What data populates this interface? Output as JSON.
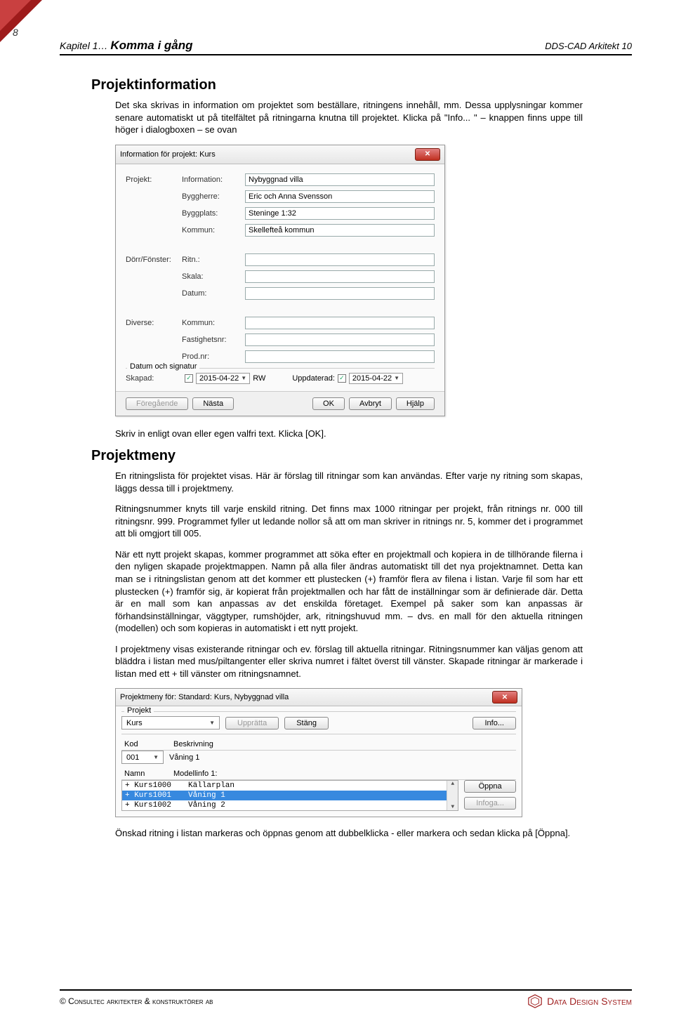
{
  "page_number": "8",
  "header": {
    "chapter": "Kapitel 1…",
    "title": "Komma i gång",
    "right": "DDS-CAD Arkitekt 10"
  },
  "section1": {
    "heading": "Projektinformation",
    "para": "Det ska skrivas in information om projektet som beställare, ritningens innehåll, mm. Dessa upplysningar kommer senare automatiskt ut på titelfältet på ritningarna knutna till projektet. Klicka på \"Info... \" – knappen finns uppe till höger i dialogboxen – se ovan"
  },
  "dialog1": {
    "title": "Information för projekt: Kurs",
    "projekt_label": "Projekt:",
    "rows_projekt": [
      {
        "label": "Information:",
        "value": "Nybyggnad villa"
      },
      {
        "label": "Byggherre:",
        "value": "Eric och Anna Svensson"
      },
      {
        "label": "Byggplats:",
        "value": "Steninge 1:32"
      },
      {
        "label": "Kommun:",
        "value": "Skellefteå kommun"
      }
    ],
    "dorr_label": "Dörr/Fönster:",
    "rows_dorr": [
      {
        "label": "Ritn.:",
        "value": ""
      },
      {
        "label": "Skala:",
        "value": ""
      },
      {
        "label": "Datum:",
        "value": ""
      }
    ],
    "diverse_label": "Diverse:",
    "rows_diverse": [
      {
        "label": "Kommun:",
        "value": ""
      },
      {
        "label": "Fastighetsnr:",
        "value": ""
      },
      {
        "label": "Prod.nr:",
        "value": ""
      }
    ],
    "signatur_label": "Datum och signatur",
    "skapad_label": "Skapad:",
    "skapad_date": "2015-04-22",
    "skapad_sign": "RW",
    "uppdaterad_label": "Uppdaterad:",
    "uppdaterad_date": "2015-04-22",
    "buttons": {
      "prev": "Föregående",
      "next": "Nästa",
      "ok": "OK",
      "cancel": "Avbryt",
      "help": "Hjälp"
    }
  },
  "after_dialog1": "Skriv in enligt ovan eller egen valfri text. Klicka [OK].",
  "section2": {
    "heading": "Projektmeny",
    "p1": "En ritningslista för projektet visas. Här är förslag till ritningar som kan användas. Efter varje ny ritning som skapas, läggs dessa till i projektmeny.",
    "p2": "Ritningsnummer knyts till varje enskild ritning. Det finns max 1000 ritningar per projekt, från ritnings nr. 000 till ritningsnr. 999. Programmet fyller ut ledande nollor så att om man skriver in ritnings nr. 5, kommer det i programmet att bli omgjort till 005.",
    "p3": "När ett nytt projekt skapas, kommer programmet att söka efter en projektmall och kopiera in de tillhörande filerna i den nyligen skapade projektmappen. Namn på alla filer ändras automatiskt till det nya projektnamnet. Detta kan man se i ritningslistan genom att det kommer ett plustecken (+) framför flera av filena i listan. Varje fil som har ett plustecken (+) framför sig, är kopierat från projektmallen och har fått de inställningar som är definierade där. Detta är en mall som kan anpassas av det enskilda företaget. Exempel på saker som kan anpassas är förhandsinställningar, väggtyper, rumshöjder, ark, ritningshuvud mm. – dvs. en mall för den aktuella ritningen (modellen) och som kopieras in automatiskt i ett nytt projekt.",
    "p4": "I projektmeny visas existerande ritningar och ev. förslag till aktuella ritningar. Ritningsnummer kan väljas genom att bläddra i listan med mus/piltangenter eller skriva numret i fältet överst till vänster. Skapade ritningar är markerade i listan med ett + till vänster om ritningsnamnet."
  },
  "dialog2": {
    "title": "Projektmeny för: Standard: Kurs, Nybyggnad villa",
    "projekt_label": "Projekt",
    "projekt_value": "Kurs",
    "uppratta": "Upprätta",
    "stang": "Stäng",
    "info": "Info...",
    "kod_label": "Kod",
    "beskrivning_label": "Beskrivning",
    "kod_value": "001",
    "beskrivning_value": "Våning 1",
    "namn_label": "Namn",
    "modell_label": "Modellinfo 1:",
    "rows": [
      {
        "name": "+ Kurs1000",
        "desc": "Källarplan"
      },
      {
        "name": "+ Kurs1001",
        "desc": "Våning 1"
      },
      {
        "name": "+ Kurs1002",
        "desc": "Våning 2"
      }
    ],
    "oppna": "Öppna",
    "infoga": "Infoga..."
  },
  "after_dialog2": "Önskad ritning i listan markeras och öppnas genom att dubbelklicka - eller markera och sedan klicka på [Öppna].",
  "footer": {
    "left": "©  Consultec arkitekter & konstruktörer ab",
    "right": "Data Design System"
  }
}
